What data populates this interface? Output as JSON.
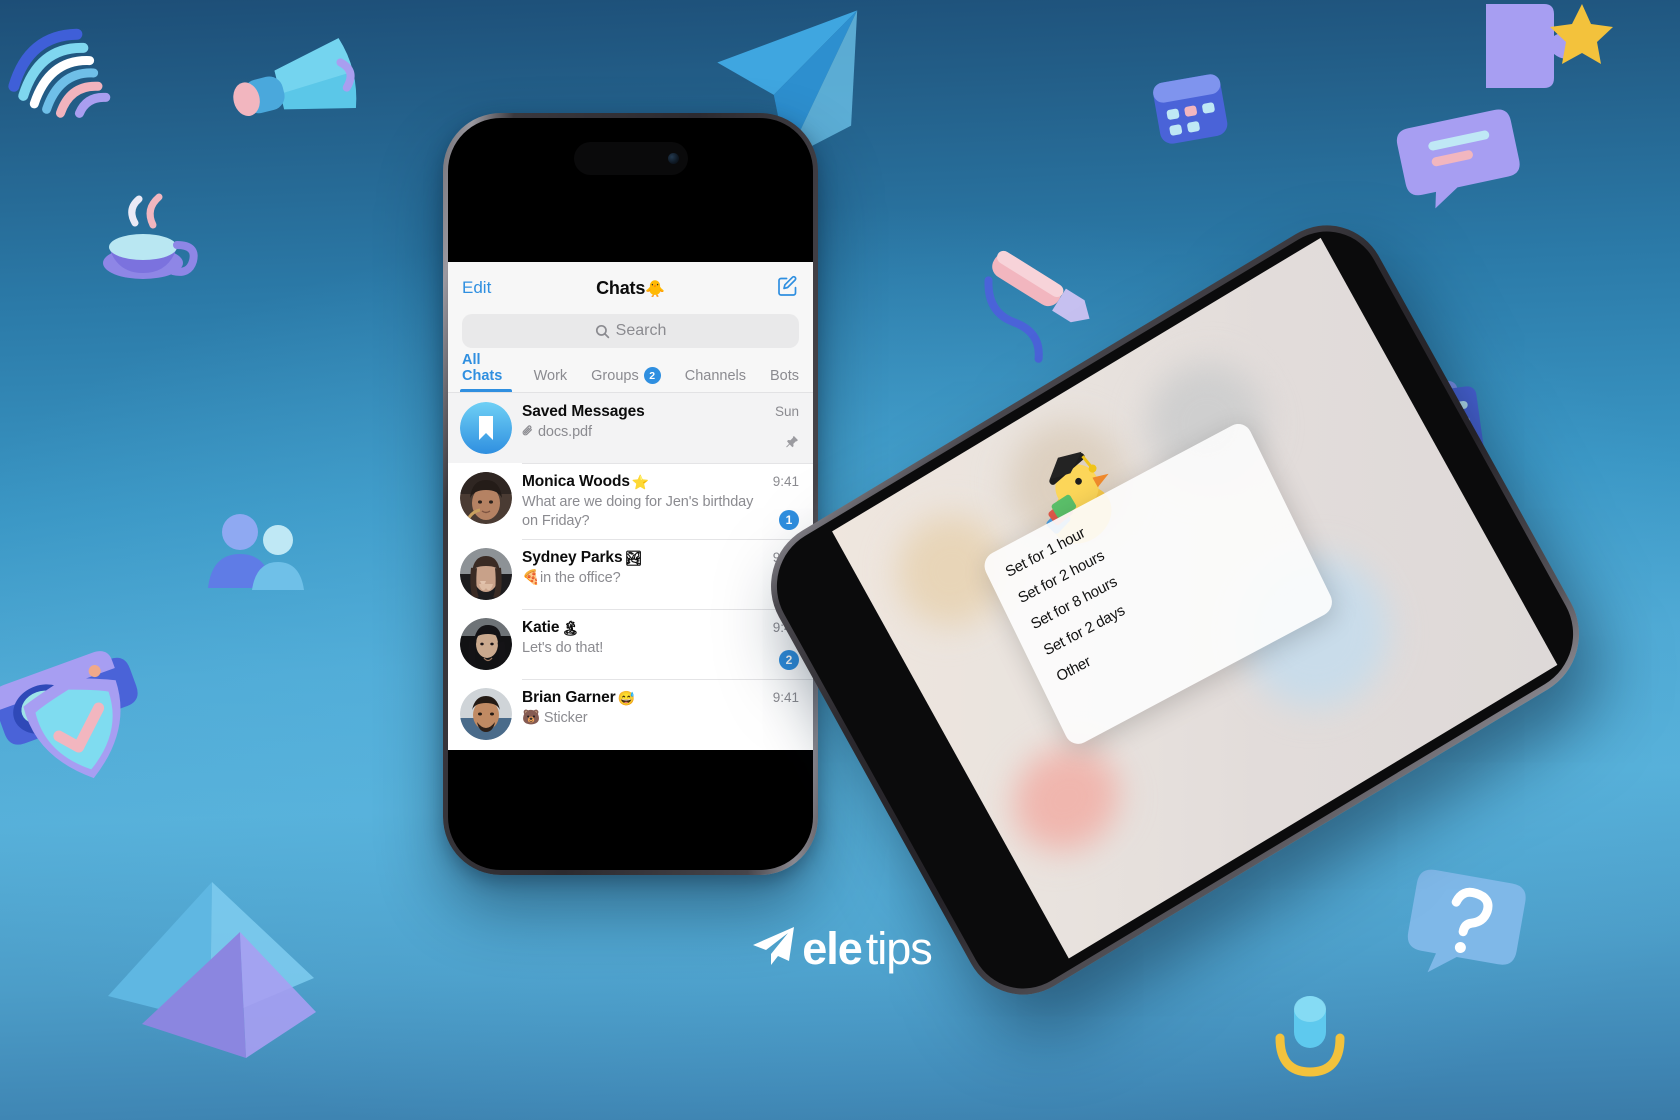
{
  "brand": {
    "logo_icon": "paper-plane-icon",
    "logo_word1": "ele",
    "logo_word2": "tips",
    "accent": "#2f8fe0",
    "background_top": "#1d4e77",
    "background_mid": "#57b0d9"
  },
  "phone1": {
    "status_icon": "dynamic-island",
    "nav": {
      "edit_label": "Edit",
      "title": "Chats",
      "title_emoji": "🐥",
      "compose_icon": "compose-icon"
    },
    "search": {
      "icon": "search-icon",
      "placeholder": "Search",
      "value": ""
    },
    "tabs": [
      {
        "label": "All Chats",
        "badge": "",
        "active": true
      },
      {
        "label": "Work",
        "badge": "",
        "active": false
      },
      {
        "label": "Groups",
        "badge": "2",
        "active": false
      },
      {
        "label": "Channels",
        "badge": "",
        "active": false
      },
      {
        "label": "Bots",
        "badge": "",
        "active": false
      }
    ],
    "chats": [
      {
        "name": "Saved Messages",
        "name_emoji": "",
        "message": "docs.pdf",
        "message_icon": "paperclip-icon",
        "time": "Sun",
        "badge": "",
        "pinned": true,
        "avatar_type": "saved-messages-bookmark"
      },
      {
        "name": "Monica Woods",
        "name_emoji": "⭐",
        "message": "What are we doing for Jen's birthday on Friday?",
        "message_icon": "",
        "time": "9:41",
        "badge": "1",
        "pinned": false,
        "avatar_type": "photo-monica"
      },
      {
        "name": "Sydney Parks",
        "name_emoji": "🏞",
        "message": "in the office?",
        "message_icon": "",
        "message_emoji": "🍕",
        "time": "9:41",
        "badge": "",
        "pinned": false,
        "avatar_type": "photo-sydney"
      },
      {
        "name": "Katie",
        "name_emoji": "🏝",
        "message": "Let's do that!",
        "message_icon": "",
        "time": "9:41",
        "badge": "2",
        "pinned": false,
        "avatar_type": "photo-katie"
      },
      {
        "name": "Brian Garner",
        "name_emoji": "😅",
        "message": "Sticker",
        "message_icon": "",
        "message_emoji": "🐻",
        "time": "9:41",
        "badge": "",
        "pinned": false,
        "avatar_type": "photo-brian"
      }
    ]
  },
  "phone2": {
    "sticker": "graduate-duck-sticker",
    "menu_items": [
      {
        "label": "Set for 1 hour"
      },
      {
        "label": "Set for 2 hours"
      },
      {
        "label": "Set for 8 hours"
      },
      {
        "label": "Set for 2 days"
      },
      {
        "label": "Other"
      }
    ]
  },
  "decor": [
    {
      "name": "fingerprint-3d"
    },
    {
      "name": "megaphone-3d"
    },
    {
      "name": "teacup-3d"
    },
    {
      "name": "camera-3d"
    },
    {
      "name": "people-3d"
    },
    {
      "name": "shield-check-3d"
    },
    {
      "name": "paper-plane-3d"
    },
    {
      "name": "pencil-3d"
    },
    {
      "name": "calendar-3d"
    },
    {
      "name": "chat-bubble-3d"
    },
    {
      "name": "documents-3d"
    },
    {
      "name": "hq-bubble-3d"
    },
    {
      "name": "question-bubble-3d"
    },
    {
      "name": "star-puzzle-3d"
    },
    {
      "name": "triangle-plane-3d"
    },
    {
      "name": "microphone-3d"
    }
  ]
}
